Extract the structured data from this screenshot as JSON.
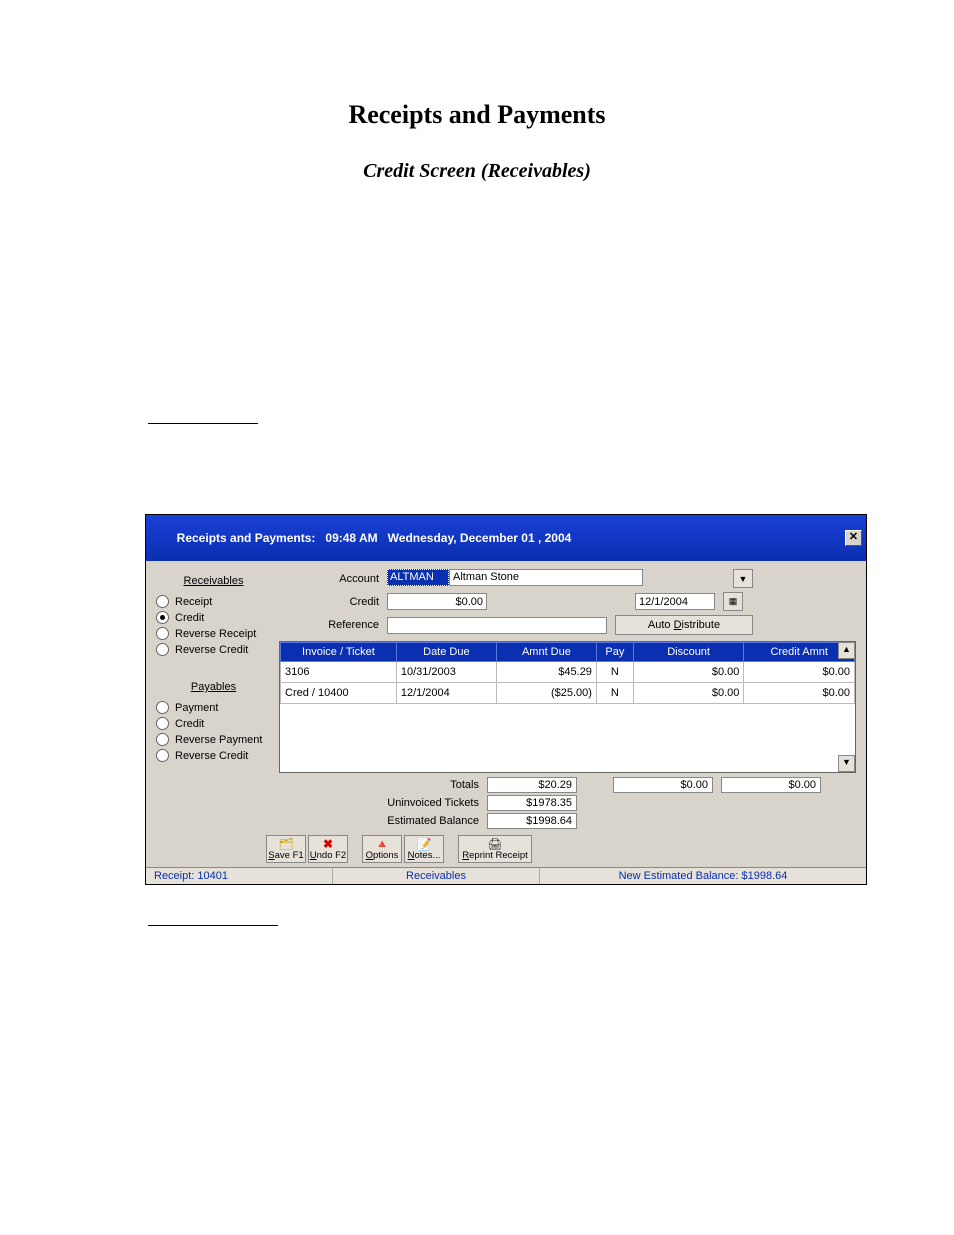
{
  "doc": {
    "title": "Receipts and Payments",
    "subtitle": "Credit Screen (Receivables)"
  },
  "window": {
    "title_prefix": "Receipts and Payments:   ",
    "time": "09:48 AM",
    "date": "Wednesday, December 01 , 2004",
    "close_glyph": "✕"
  },
  "sidebar": {
    "receivables": {
      "heading": "Receivables",
      "options": [
        {
          "label": "Receipt",
          "selected": false
        },
        {
          "label": "Credit",
          "selected": true
        },
        {
          "label": "Reverse Receipt",
          "selected": false
        },
        {
          "label": "Reverse Credit",
          "selected": false
        }
      ]
    },
    "payables": {
      "heading": "Payables",
      "options": [
        {
          "label": "Payment",
          "selected": false
        },
        {
          "label": "Credit",
          "selected": false
        },
        {
          "label": "Reverse Payment",
          "selected": false
        },
        {
          "label": "Reverse Credit",
          "selected": false
        }
      ]
    }
  },
  "form": {
    "account_label": "Account",
    "account_code": "ALTMAN",
    "account_name": "Altman Stone",
    "credit_label": "Credit",
    "credit_value": "$0.00",
    "date_value": "12/1/2004",
    "reference_label": "Reference",
    "reference_value": "",
    "auto_distribute_label": "Auto Distribute",
    "auto_distribute_underline": "D"
  },
  "table": {
    "headers": [
      "Invoice / Ticket",
      "Date Due",
      "Amnt Due",
      "Pay",
      "Discount",
      "Credit Amnt"
    ],
    "rows": [
      {
        "inv": "3106",
        "due": "10/31/2003",
        "amt": "$45.29",
        "pay": "N",
        "disc": "$0.00",
        "cred": "$0.00"
      },
      {
        "inv": "Cred / 10400",
        "due": "12/1/2004",
        "amt": "($25.00)",
        "pay": "N",
        "disc": "$0.00",
        "cred": "$0.00"
      }
    ]
  },
  "totals": {
    "totals_label": "Totals",
    "totals_amt": "$20.29",
    "totals_disc": "$0.00",
    "totals_cred": "$0.00",
    "uninvoiced_label": "Uninvoiced Tickets",
    "uninvoiced_value": "$1978.35",
    "est_bal_label": "Estimated Balance",
    "est_bal_value": "$1998.64"
  },
  "toolbar": {
    "save": "Save F1",
    "undo": "Undo F2",
    "options": "Options",
    "notes": "Notes...",
    "reprint": "Reprint Receipt"
  },
  "status": {
    "receipt": "Receipt:  10401",
    "mode": "Receivables",
    "balance": "New Estimated Balance:   $1998.64"
  }
}
